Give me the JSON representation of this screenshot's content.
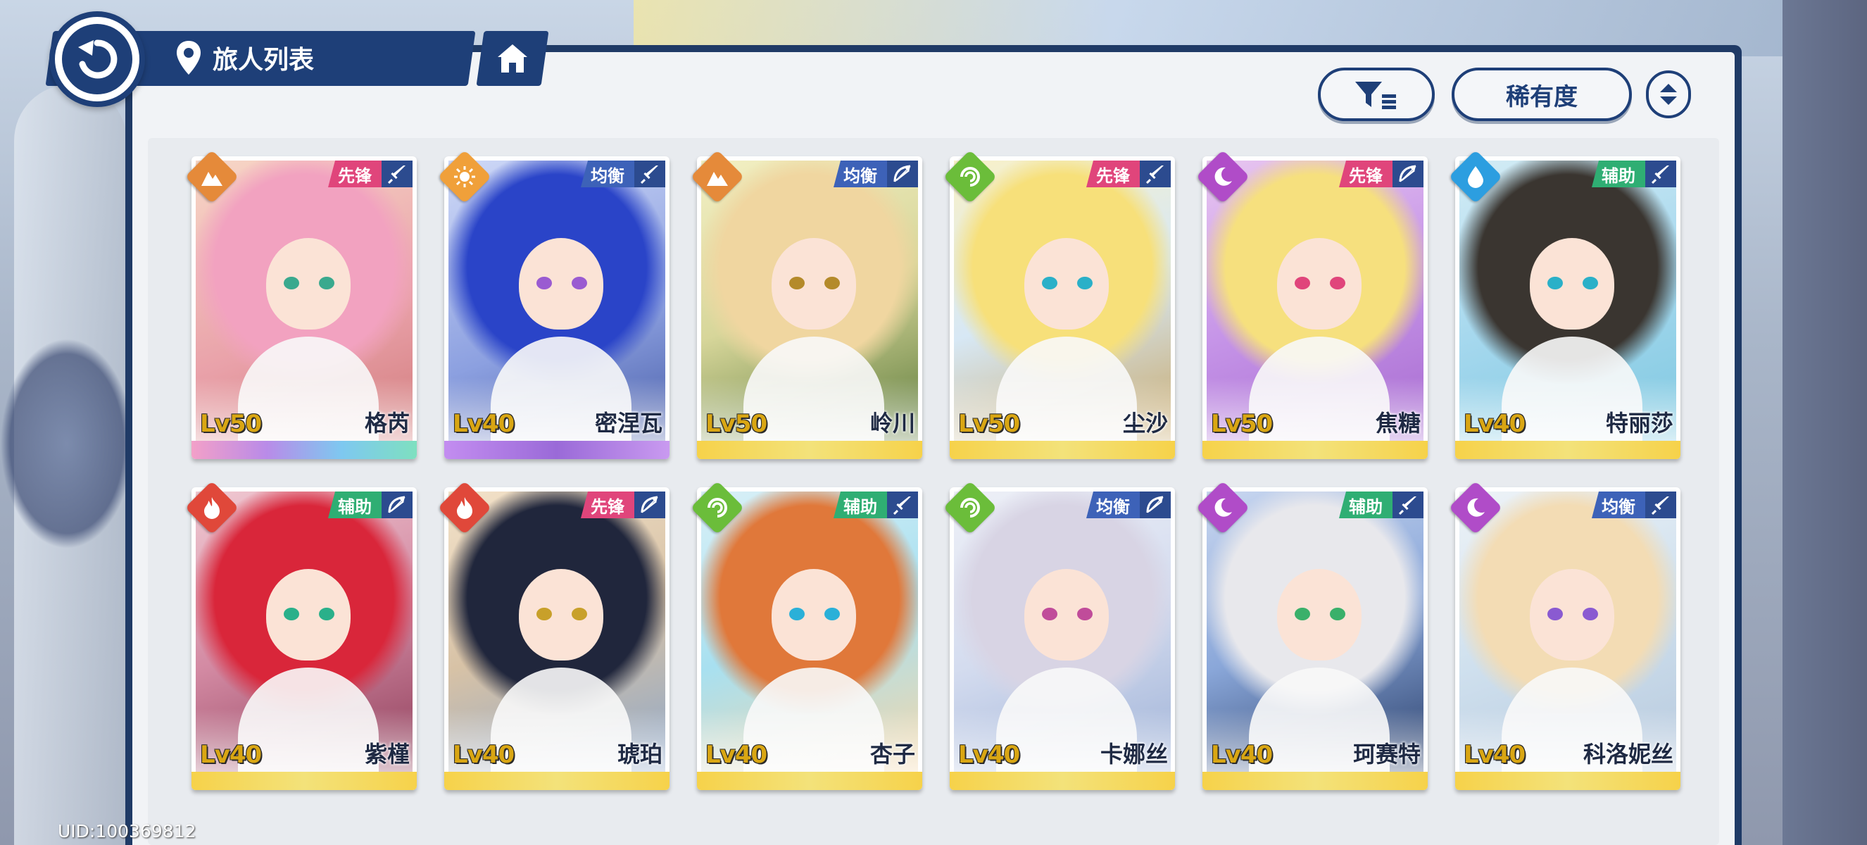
{
  "header": {
    "title": "旅人列表"
  },
  "controls": {
    "sort_label": "稀有度"
  },
  "footer": {
    "uid": "UID:100369812"
  },
  "colors": {
    "panel_border": "#1e3f78",
    "role_pink": "#e0457b",
    "role_blue": "#3d62b8",
    "role_green": "#2fae73",
    "level_gold": "#d9a613"
  },
  "characters": [
    {
      "name": "格芮",
      "level": "Lv50",
      "role": "先锋",
      "element": "mountain-icon",
      "weapon": "sword-icon",
      "role_color": "#e0457b",
      "element_color": "#e58a3a",
      "hair": "#f2a2c0",
      "eye": "#3aa98e",
      "strip": "rainbow"
    },
    {
      "name": "密涅瓦",
      "level": "Lv40",
      "role": "均衡",
      "element": "sun-icon",
      "weapon": "sword-icon",
      "role_color": "#3d62b8",
      "element_color": "#f0a03a",
      "hair": "#2a44c8",
      "eye": "#9a5bd1",
      "strip": "purple"
    },
    {
      "name": "岭川",
      "level": "Lv50",
      "role": "均衡",
      "element": "mountain-icon",
      "weapon": "bow-icon",
      "role_color": "#3d62b8",
      "element_color": "#e58a3a",
      "hair": "#f0d6a0",
      "eye": "#b48a2a",
      "strip": "gold"
    },
    {
      "name": "尘沙",
      "level": "Lv50",
      "role": "先锋",
      "element": "wind-icon",
      "weapon": "sword-icon",
      "role_color": "#e0457b",
      "element_color": "#6bbd3a",
      "hair": "#f7e07a",
      "eye": "#2ab0c8",
      "strip": "gold"
    },
    {
      "name": "焦糖",
      "level": "Lv50",
      "role": "先锋",
      "element": "moon-icon",
      "weapon": "bow-icon",
      "role_color": "#e0457b",
      "element_color": "#b04cc8",
      "hair": "#f6e07e",
      "eye": "#e0457b",
      "strip": "gold"
    },
    {
      "name": "特丽莎",
      "level": "Lv40",
      "role": "辅助",
      "element": "water-icon",
      "weapon": "sword-icon",
      "role_color": "#2fae73",
      "element_color": "#2c9ee0",
      "hair": "#3a3530",
      "eye": "#2ab0c8",
      "strip": "gold"
    },
    {
      "name": "紫槿",
      "level": "Lv40",
      "role": "辅助",
      "element": "fire-icon",
      "weapon": "bow-icon",
      "role_color": "#2fae73",
      "element_color": "#e0483a",
      "hair": "#d9263a",
      "eye": "#2ab08a",
      "strip": "gold"
    },
    {
      "name": "琥珀",
      "level": "Lv40",
      "role": "先锋",
      "element": "fire-icon",
      "weapon": "bow-icon",
      "role_color": "#e0457b",
      "element_color": "#e0483a",
      "hair": "#20263c",
      "eye": "#c8a02a",
      "strip": "gold"
    },
    {
      "name": "杏子",
      "level": "Lv40",
      "role": "辅助",
      "element": "wind-icon",
      "weapon": "sword-icon",
      "role_color": "#2fae73",
      "element_color": "#6bbd3a",
      "hair": "#e0783a",
      "eye": "#2ab0d8",
      "strip": "gold"
    },
    {
      "name": "卡娜丝",
      "level": "Lv40",
      "role": "均衡",
      "element": "wind-icon",
      "weapon": "bow-icon",
      "role_color": "#3d62b8",
      "element_color": "#6bbd3a",
      "hair": "#d8d4e4",
      "eye": "#c04c9a",
      "strip": "gold"
    },
    {
      "name": "珂赛特",
      "level": "Lv40",
      "role": "辅助",
      "element": "moon-icon",
      "weapon": "sword-icon",
      "role_color": "#2fae73",
      "element_color": "#b04cc8",
      "hair": "#e8e8ec",
      "eye": "#3ab06a",
      "strip": "gold"
    },
    {
      "name": "科洛妮丝",
      "level": "Lv40",
      "role": "均衡",
      "element": "moon-icon",
      "weapon": "sword-icon",
      "role_color": "#3d62b8",
      "element_color": "#b04cc8",
      "hair": "#f3dcb4",
      "eye": "#8a5ad1",
      "strip": "gold"
    }
  ]
}
